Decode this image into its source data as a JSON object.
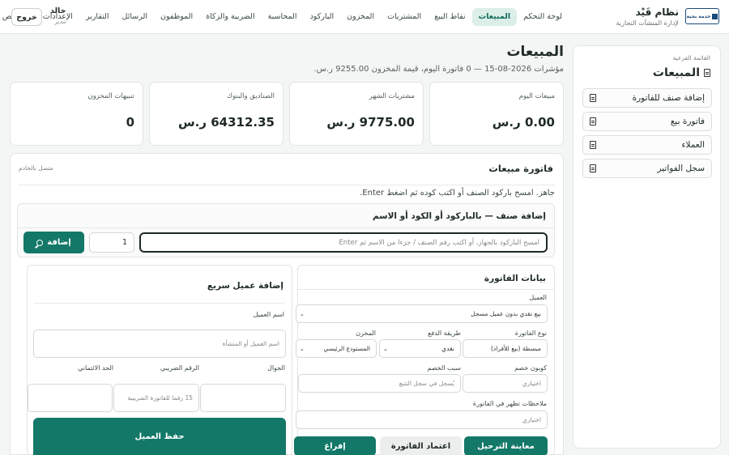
{
  "brand": {
    "logo_text": "خدمة بحية",
    "title": "نظام قَيْد",
    "subtitle": "لإدارة المنشآت التجارية"
  },
  "nav": [
    {
      "label": "لوحة التحكم",
      "active": false
    },
    {
      "label": "المبيعات",
      "active": true
    },
    {
      "label": "نقاط البيع",
      "active": false
    },
    {
      "label": "المشتريات",
      "active": false
    },
    {
      "label": "المخزون",
      "active": false
    },
    {
      "label": "الباركود",
      "active": false
    },
    {
      "label": "المحاسبة",
      "active": false
    },
    {
      "label": "الضريبة والزكاة",
      "active": false
    },
    {
      "label": "الموظفون",
      "active": false
    },
    {
      "label": "الرسائل",
      "active": false
    },
    {
      "label": "التقارير",
      "active": false
    },
    {
      "label": "الإعدادات",
      "active": false
    },
    {
      "label": "الترخيص",
      "active": false
    }
  ],
  "user": {
    "name": "خالد",
    "role": "مدير",
    "logout_label": "خروج"
  },
  "subside": {
    "caption": "القائمة الفرعية",
    "title": "المبيعات",
    "items": [
      {
        "label": "إضافة صنف للفاتورة"
      },
      {
        "label": "فاتورة بيع"
      },
      {
        "label": "العملاء"
      },
      {
        "label": "سجل الفواتير"
      }
    ]
  },
  "page": {
    "title": "المبيعات",
    "kpi": "مؤشرات 2026-08-15 — 0 فاتورة اليوم، قيمة المخزون 9255.00 ر.س."
  },
  "cards": [
    {
      "label": "مبيعات اليوم",
      "value": "0.00 ر.س"
    },
    {
      "label": "مشتريات الشهر",
      "value": "9775.00 ر.س"
    },
    {
      "label": "الصناديق والبنوك",
      "value": "64312.35 ر.س"
    },
    {
      "label": "تنبيهات المخزون",
      "value": "0"
    }
  ],
  "invoice": {
    "title": "فاتورة مبيعات",
    "status": "متصل بالخادم",
    "hint": "جاهز. امسح باركود الصنف أو اكتب كوده ثم اضغط Enter.",
    "add_title": "إضافة صنف — بالباركود أو الكود أو الاسم",
    "search_placeholder": "امسح الباركود بالجهاز، أو اكتب رقم الصنف / جزءا من الاسم ثم Enter",
    "qty_value": "1",
    "add_button": "إضافة"
  },
  "details": {
    "title": "بيانات الفاتورة",
    "customer_label": "العميل",
    "customer_value": "بيع نقدي بدون عميل مسجل",
    "type_label": "نوع الفاتورة",
    "type_value": "مبسطة (بيع للأفراد)",
    "payment_label": "طريقة الدفع",
    "payment_value": "نقدي",
    "warehouse_label": "المخزن",
    "warehouse_value": "المستودع الرئيسي",
    "coupon_label": "كوبون خصم",
    "coupon_placeholder": "اختياري",
    "reason_label": "سبب الخصم",
    "reason_placeholder": "يُسجل في سجل التتبع",
    "notes_label": "ملاحظات تظهر في الفاتورة",
    "notes_placeholder": "اختياري",
    "preview_button": "معاينة الترحيل",
    "approve_button": "اعتماد الفاتورة",
    "clear_button": "إفراغ"
  },
  "quick": {
    "title": "إضافة عميل سريع",
    "name_label": "اسم العميل",
    "name_placeholder": "اسم العميل أو المنشأة",
    "phone_label": "الجوال",
    "tax_label": "الرقم الضريبي",
    "tax_placeholder": "15 رقما للفاتورة الضريبية",
    "credit_label": "الحد الائتماني",
    "save_button": "حفظ العميل"
  }
}
